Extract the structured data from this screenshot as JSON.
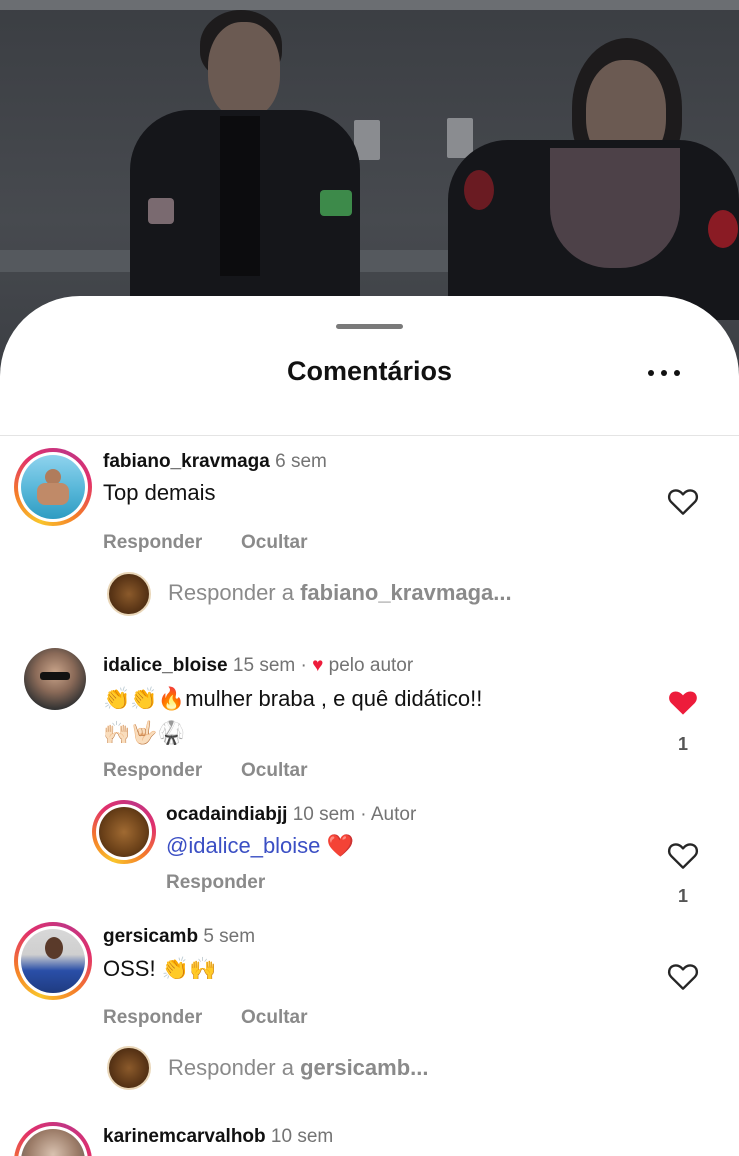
{
  "sheet": {
    "title": "Comentários"
  },
  "actions": {
    "reply": "Responder",
    "hide": "Ocultar"
  },
  "comments": [
    {
      "username": "fabiano_kravmaga",
      "time": "6 sem",
      "text": "Top demais",
      "reply_prompt_prefix": "Responder a ",
      "reply_prompt_user": "fabiano_kravmaga..."
    },
    {
      "username": "idalice_bloise",
      "time": "15 sem",
      "liked_by_author": "pelo autor",
      "text_emojis_before": "👏👏🔥",
      "text": "mulher braba , e quê didático!!",
      "text_line2": "🙌🏻🤟🏻🥋",
      "likes": "1"
    },
    {
      "username": "ocadaindiabjj",
      "time": "10 sem",
      "role": "Autor",
      "mention": "@idalice_bloise",
      "text_emoji": "❤️",
      "likes": "1"
    },
    {
      "username": "gersicamb",
      "time": "5 sem",
      "text": "OSS!",
      "text_emoji": "👏🙌",
      "reply_prompt_prefix": "Responder a ",
      "reply_prompt_user": "gersicamb..."
    },
    {
      "username": "karinemcarvalhob",
      "time": "10 sem"
    }
  ],
  "colors": {
    "heart_liked": "#ed1c3b",
    "mention": "#3b4fc4",
    "muted": "#8a8a8a"
  },
  "icons": [
    "more-icon",
    "heart-outline-icon",
    "heart-filled-icon"
  ]
}
